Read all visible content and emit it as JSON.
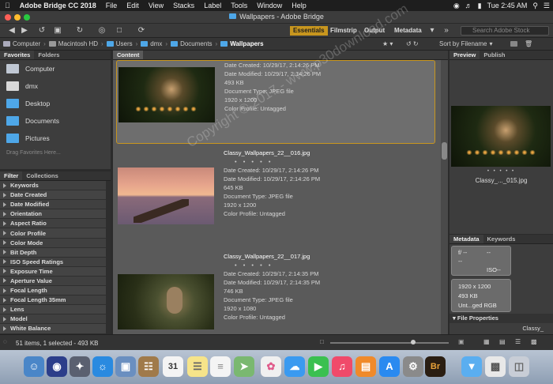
{
  "menubar": {
    "apple": "",
    "app_name": "Adobe Bridge CC 2018",
    "items": [
      "File",
      "Edit",
      "View",
      "Stacks",
      "Label",
      "Tools",
      "Window",
      "Help"
    ],
    "clock": "Tue 2:45 AM"
  },
  "window": {
    "title": "Wallpapers - Adobe Bridge"
  },
  "toolbar": {
    "workspaces": [
      "Essentials",
      "Filmstrip",
      "Output",
      "Metadata"
    ],
    "search_placeholder": "Search Adobe Stock"
  },
  "path": {
    "crumbs": [
      "Computer",
      "Macintosh HD",
      "Users",
      "dmx",
      "Documents",
      "Wallpapers"
    ],
    "sort_label": "Sort by Filename"
  },
  "favorites": {
    "tabs": [
      "Favorites",
      "Folders"
    ],
    "items": [
      "Computer",
      "dmx",
      "Desktop",
      "Documents",
      "Pictures"
    ],
    "hint": "Drag Favorites Here..."
  },
  "filter": {
    "tabs": [
      "Filter",
      "Collections"
    ],
    "rows": [
      "Keywords",
      "Date Created",
      "Date Modified",
      "Orientation",
      "Aspect Ratio",
      "Color Profile",
      "Color Mode",
      "Bit Depth",
      "ISO Speed Ratings",
      "Exposure Time",
      "Aperture Value",
      "Focal Length",
      "Focal Length 35mm",
      "Lens",
      "Model",
      "White Balance"
    ]
  },
  "content": {
    "tab": "Content",
    "items": [
      {
        "filename": "",
        "dots": "",
        "created": "Date Created: 10/29/17, 2:14:26 PM",
        "modified": "Date Modified: 10/29/17, 2:14:26 PM",
        "size": "493 KB",
        "type": "Document Type: JPEG file",
        "dims": "1920 x 1200",
        "profile": "Color Profile: Untagged"
      },
      {
        "filename": "Classy_Wallpapers_22__016.jpg",
        "dots": "• • • • •",
        "created": "Date Created: 10/29/17, 2:14:26 PM",
        "modified": "Date Modified: 10/29/17, 2:14:26 PM",
        "size": "645 KB",
        "type": "Document Type: JPEG file",
        "dims": "1920 x 1200",
        "profile": "Color Profile: Untagged"
      },
      {
        "filename": "Classy_Wallpapers_22__017.jpg",
        "dots": "• • • • •",
        "created": "Date Created: 10/29/17, 2:14:35 PM",
        "modified": "Date Modified: 10/29/17, 2:14:35 PM",
        "size": "746 KB",
        "type": "Document Type: JPEG file",
        "dims": "1920 x 1080",
        "profile": "Color Profile: Untagged"
      }
    ],
    "watermark": "Copyright © 2017 - www.p30download.com"
  },
  "preview": {
    "tabs": [
      "Preview",
      "Publish"
    ],
    "dots": "• • • • •",
    "filename": "Classy_..._015.jpg"
  },
  "metadata": {
    "tabs": [
      "Metadata",
      "Keywords"
    ],
    "fstop": "f/ --",
    "shutter": "--",
    "exposure": "--",
    "iso": "ISO--",
    "dims": "1920 x 1200",
    "size": "493 KB",
    "color": "Unt...ged RGB",
    "section": "File Properties",
    "filename_short": "Classy_"
  },
  "status": {
    "text": "51 items, 1 selected - 493 KB"
  },
  "dock": {
    "adobe_br_label": "Br",
    "calendar_day": "31"
  }
}
